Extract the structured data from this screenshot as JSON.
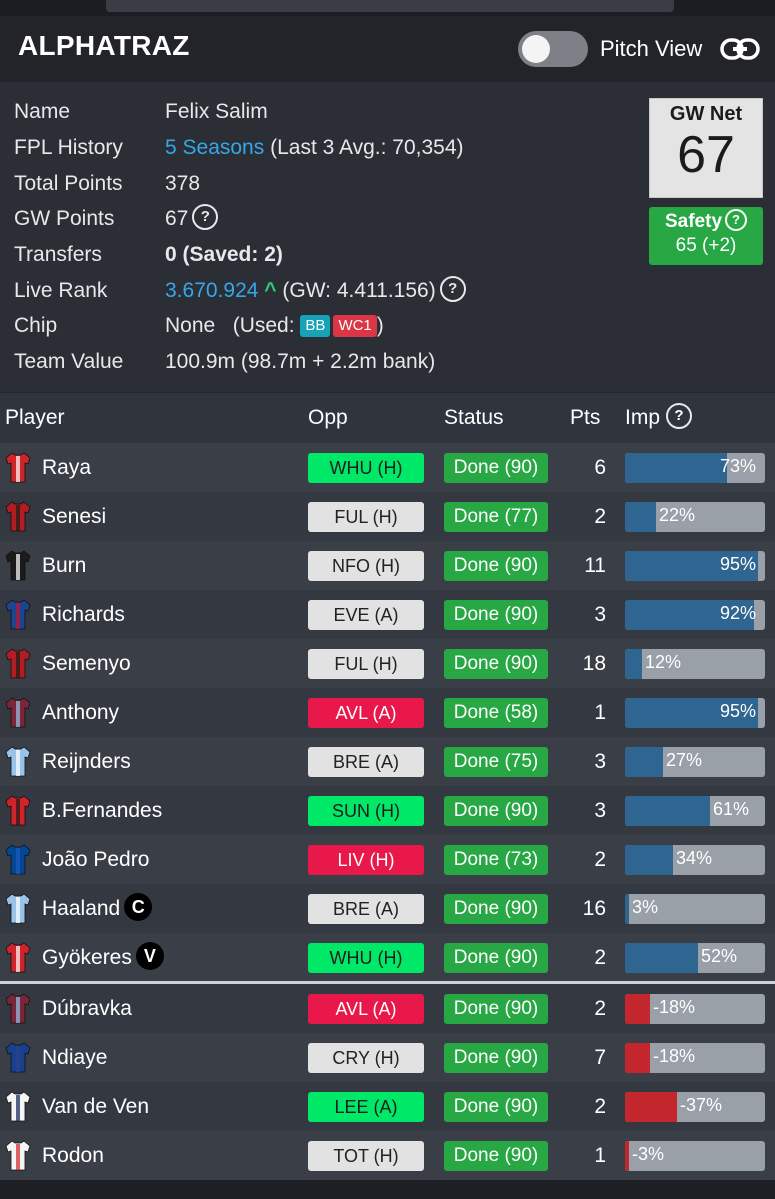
{
  "app": {
    "title": "ALPHATRAZ",
    "pitch_view_label": "Pitch View",
    "pitch_view_on": false
  },
  "info": {
    "name": {
      "label": "Name",
      "value": "Felix Salim"
    },
    "history": {
      "label": "FPL History",
      "link": "5 Seasons",
      "rest": "(Last 3 Avg.: 70,354)"
    },
    "total_points": {
      "label": "Total Points",
      "value": "378"
    },
    "gw_points": {
      "label": "GW Points",
      "value": "67"
    },
    "transfers": {
      "label": "Transfers",
      "value": "0 (Saved: 2)"
    },
    "live_rank": {
      "label": "Live Rank",
      "value": "3.670.924",
      "arrow": "^",
      "gw": "(GW: 4.411.156)"
    },
    "chip": {
      "label": "Chip",
      "value": "None",
      "used_prefix": "(Used:",
      "used_suffix": ")",
      "chips": [
        "BB",
        "WC1"
      ]
    },
    "team_value": {
      "label": "Team Value",
      "value": "100.9m (98.7m + 2.2m bank)"
    }
  },
  "gw_net": {
    "label": "GW Net",
    "value": "67"
  },
  "safety": {
    "label": "Safety",
    "value": "65 (+2)"
  },
  "table": {
    "headers": {
      "player": "Player",
      "opp": "Opp",
      "status": "Status",
      "pts": "Pts",
      "imp": "Imp"
    },
    "rows": [
      {
        "name": "Raya",
        "opp": "WHU (H)",
        "opp_level": "easy",
        "status": "Done (90)",
        "pts": "6",
        "imp": "73%",
        "imp_value": 73,
        "kit": [
          "#d0242b",
          "#ffffff"
        ],
        "badge": ""
      },
      {
        "name": "Senesi",
        "opp": "FUL (H)",
        "opp_level": "mid",
        "status": "Done (77)",
        "pts": "2",
        "imp": "22%",
        "imp_value": 22,
        "kit": [
          "#b01e23",
          "#1b1b1b"
        ],
        "badge": ""
      },
      {
        "name": "Burn",
        "opp": "NFO (H)",
        "opp_level": "mid",
        "status": "Done (90)",
        "pts": "11",
        "imp": "95%",
        "imp_value": 95,
        "kit": [
          "#1b1b1b",
          "#ffffff"
        ],
        "badge": ""
      },
      {
        "name": "Richards",
        "opp": "EVE (A)",
        "opp_level": "mid",
        "status": "Done (90)",
        "pts": "3",
        "imp": "92%",
        "imp_value": 92,
        "kit": [
          "#1b458f",
          "#c4122e"
        ],
        "badge": ""
      },
      {
        "name": "Semenyo",
        "opp": "FUL (H)",
        "opp_level": "mid",
        "status": "Done (90)",
        "pts": "18",
        "imp": "12%",
        "imp_value": 12,
        "kit": [
          "#b01e23",
          "#1b1b1b"
        ],
        "badge": ""
      },
      {
        "name": "Anthony",
        "opp": "AVL (A)",
        "opp_level": "hard",
        "status": "Done (58)",
        "pts": "1",
        "imp": "95%",
        "imp_value": 95,
        "kit": [
          "#7a263a",
          "#95bfe5"
        ],
        "badge": ""
      },
      {
        "name": "Reijnders",
        "opp": "BRE (A)",
        "opp_level": "mid",
        "status": "Done (75)",
        "pts": "3",
        "imp": "27%",
        "imp_value": 27,
        "kit": [
          "#9ac3e8",
          "#ffffff"
        ],
        "badge": ""
      },
      {
        "name": "B.Fernandes",
        "opp": "SUN (H)",
        "opp_level": "easy",
        "status": "Done (90)",
        "pts": "3",
        "imp": "61%",
        "imp_value": 61,
        "kit": [
          "#d0242b",
          "#1b1b1b"
        ],
        "badge": ""
      },
      {
        "name": "João Pedro",
        "opp": "LIV (H)",
        "opp_level": "hard",
        "status": "Done (73)",
        "pts": "2",
        "imp": "34%",
        "imp_value": 34,
        "kit": [
          "#034694",
          "#1e5cc0"
        ],
        "badge": ""
      },
      {
        "name": "Haaland",
        "opp": "BRE (A)",
        "opp_level": "mid",
        "status": "Done (90)",
        "pts": "16",
        "imp": "3%",
        "imp_value": 3,
        "kit": [
          "#9ac3e8",
          "#ffffff"
        ],
        "badge": "C"
      },
      {
        "name": "Gyökeres",
        "opp": "WHU (H)",
        "opp_level": "easy",
        "status": "Done (90)",
        "pts": "2",
        "imp": "52%",
        "imp_value": 52,
        "kit": [
          "#d0242b",
          "#ffffff"
        ],
        "badge": "V"
      },
      {
        "name": "Dúbravka",
        "opp": "AVL (A)",
        "opp_level": "hard",
        "status": "Done (90)",
        "pts": "2",
        "imp": "-18%",
        "imp_value": -18,
        "kit": [
          "#7a263a",
          "#95bfe5"
        ],
        "badge": ""
      },
      {
        "name": "Ndiaye",
        "opp": "CRY (H)",
        "opp_level": "mid",
        "status": "Done (90)",
        "pts": "7",
        "imp": "-18%",
        "imp_value": -18,
        "kit": [
          "#1b3f8f",
          "#274488"
        ],
        "badge": ""
      },
      {
        "name": "Van de Ven",
        "opp": "LEE (A)",
        "opp_level": "easy",
        "status": "Done (90)",
        "pts": "2",
        "imp": "-37%",
        "imp_value": -37,
        "kit": [
          "#f5f5f5",
          "#132257"
        ],
        "badge": ""
      },
      {
        "name": "Rodon",
        "opp": "TOT (H)",
        "opp_level": "mid",
        "status": "Done (90)",
        "pts": "1",
        "imp": "-3%",
        "imp_value": -3,
        "kit": [
          "#f5f5f5",
          "#d0242b"
        ],
        "badge": ""
      }
    ]
  },
  "colors": {
    "accent_blue": "#36a7e9",
    "success": "#28a745",
    "danger": "#dc3545",
    "imp_positive": "#2f6591",
    "imp_negative": "#c4262e"
  }
}
